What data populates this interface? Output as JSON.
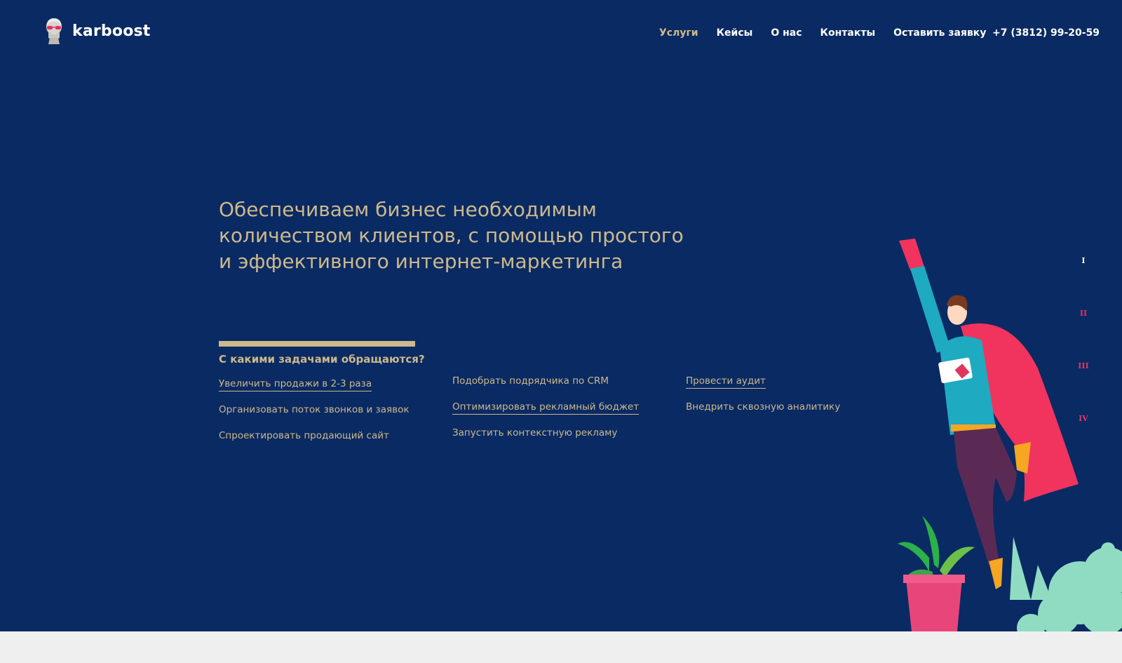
{
  "brand": {
    "name": "karboost"
  },
  "nav": {
    "items": [
      {
        "label": "Услуги",
        "active": true
      },
      {
        "label": "Кейсы",
        "active": false
      },
      {
        "label": "О нас",
        "active": false
      },
      {
        "label": "Контакты",
        "active": false
      },
      {
        "label": "Оставить заявку",
        "active": false
      }
    ],
    "phone": "+7 (3812) 99-20-59"
  },
  "hero": {
    "headline_line1": "Обеспечиваем бизнес необходимым",
    "headline_line2": "количеством клиентов, с помощью простого",
    "headline_line3": "и эффективного интернет-маркетинга",
    "tasks_heading": "С какими задачами обращаются?",
    "tasks": [
      [
        "Увеличить продажи в 2-3 раза",
        "Организовать поток звонков и заявок",
        "Спроектировать продающий сайт"
      ],
      [
        "Подобрать подрядчика по CRM",
        "Оптимизировать рекламный бюджет",
        "Запустить контекстную рекламу"
      ],
      [
        "Провести аудит",
        "Внедрить сквозную аналитику"
      ]
    ]
  },
  "slides": {
    "labels": [
      "I",
      "II",
      "III",
      "IV"
    ],
    "current": 1
  },
  "colors": {
    "background": "#0a2a63",
    "accent_gold": "#cdb98b",
    "accent_red": "#e2345f",
    "cape": "#f0345e",
    "shirt": "#1eaac0",
    "pants": "#5a2a55",
    "smoke": "#8fdcc3",
    "plant_leaf": "#2bb04a",
    "footer": "#efefef"
  },
  "icons": {
    "logo": "bust-with-glasses-icon",
    "illustration": "flying-superhero-illustration"
  }
}
